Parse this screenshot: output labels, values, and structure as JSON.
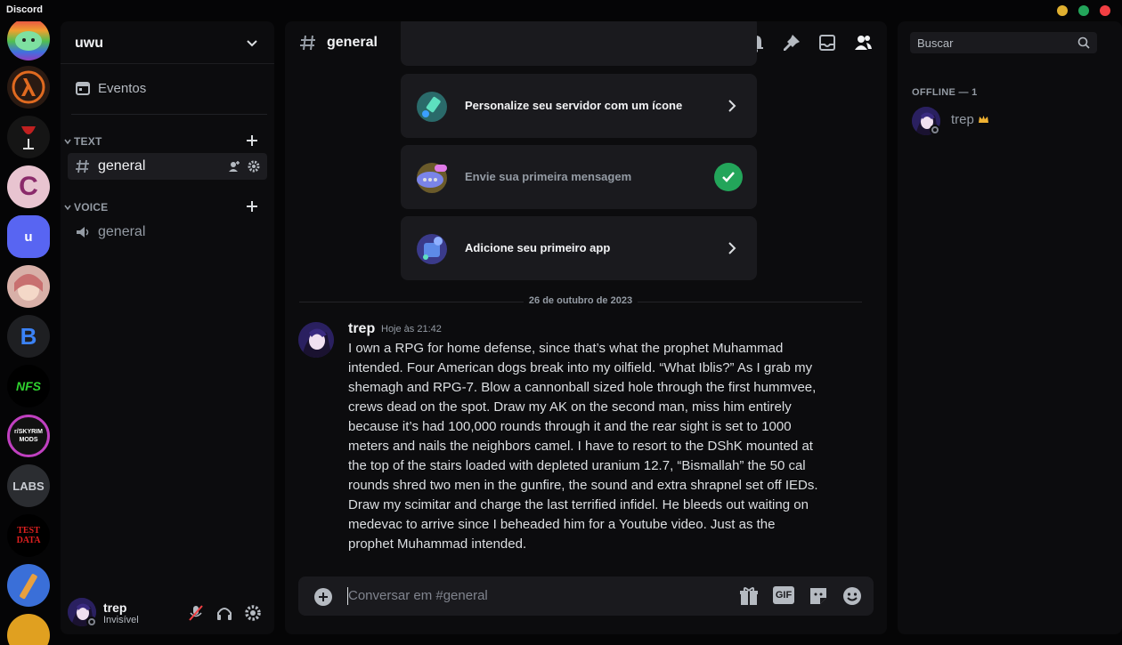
{
  "app": {
    "title": "Discord"
  },
  "window_controls": {
    "colors": [
      "#e0b030",
      "#23a55a",
      "#f23f43"
    ]
  },
  "servers": [
    {
      "name": "server-rainbow-cat",
      "label": "",
      "bg": "#e8507a"
    },
    {
      "name": "server-half-life",
      "label": "",
      "bg": "#2a1a12"
    },
    {
      "name": "server-wine",
      "label": "",
      "bg": "#151515"
    },
    {
      "name": "server-c",
      "label": "C",
      "bg": "#e8c4d0"
    },
    {
      "name": "server-u",
      "label": "u",
      "bg": "#5865f2"
    },
    {
      "name": "server-anime",
      "label": "",
      "bg": "#d8b0a8"
    },
    {
      "name": "server-bd",
      "label": "B",
      "bg": "#1e1f22"
    },
    {
      "name": "server-nfs",
      "label": "NFS",
      "bg": "#000000"
    },
    {
      "name": "server-skyrim-mods",
      "label": "r/SKYRIM MODS",
      "bg": "#111111"
    },
    {
      "name": "server-shader-labs",
      "label": "LABS",
      "bg": "#2b2d31"
    },
    {
      "name": "server-test-data",
      "label": "TEST DATA",
      "bg": "#000000"
    },
    {
      "name": "server-tool",
      "label": "",
      "bg": "#3a6fd8"
    },
    {
      "name": "server-partial",
      "label": "",
      "bg": "#e0a020"
    }
  ],
  "sidebar": {
    "guild_name": "uwu",
    "events_label": "Eventos",
    "categories": [
      {
        "label": "TEXT",
        "channels": [
          {
            "name": "general",
            "type": "text",
            "active": true
          }
        ]
      },
      {
        "label": "VOICE",
        "channels": [
          {
            "name": "general",
            "type": "voice",
            "active": false
          }
        ]
      }
    ]
  },
  "user_panel": {
    "username": "trep",
    "status": "Invisível"
  },
  "chat": {
    "channel_name": "general",
    "checklist": [
      {
        "label": "Personalize seu servidor com um ícone",
        "done": false
      },
      {
        "label": "Envie sua primeira mensagem",
        "done": true
      },
      {
        "label": "Adicione seu primeiro app",
        "done": false
      }
    ],
    "date_separator": "26 de outubro de 2023",
    "message": {
      "author": "trep",
      "timestamp": "Hoje às 21:42",
      "lines": [
        "I own a RPG for home defense, since that’s what the prophet Muhammad",
        "intended. Four American dogs break into my oilfield. “What Iblis?” As I grab my",
        "shemagh and RPG-7. Blow a cannonball sized hole through the first hummvee,",
        "crews dead on the spot. Draw my AK on the second man, miss him entirely",
        "because it’s had 100,000 rounds through it and the rear sight is set to 1000",
        "meters and nails the neighbors camel. I have to resort to the DShK mounted at",
        "the top of the stairs loaded with depleted uranium 12.7, “Bismallah” the 50 cal",
        "rounds shred two men in the gunfire, the sound and extra shrapnel set off IEDs.",
        "Draw my scimitar and charge the last terrified infidel. He bleeds out waiting on",
        "medevac to arrive since I beheaded him for a Youtube video. Just as the",
        "prophet Muhammad intended."
      ]
    },
    "composer_placeholder": "Conversar em #general",
    "composer_gif_label": "GIF"
  },
  "members": {
    "search_placeholder": "Buscar",
    "groups": [
      {
        "label": "OFFLINE — 1",
        "users": [
          {
            "name": "trep",
            "owner": true
          }
        ]
      }
    ]
  }
}
